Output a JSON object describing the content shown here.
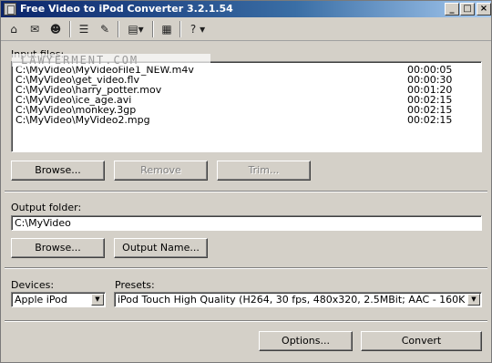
{
  "window": {
    "title": "Free Video to iPod Converter 3.2.1.54",
    "controls": {
      "minimize": "_",
      "maximize": "□",
      "close": "×"
    }
  },
  "toolbar": {
    "tools": [
      {
        "icon": "home-icon",
        "glyph": "⌂"
      },
      {
        "icon": "mail-icon",
        "glyph": "✉"
      },
      {
        "icon": "user-icon",
        "glyph": "☻"
      },
      {
        "icon": "list-icon",
        "glyph": "☰"
      },
      {
        "icon": "pencil-icon",
        "glyph": "✎"
      },
      {
        "icon": "window-menu-icon",
        "glyph": "▤▾"
      },
      {
        "icon": "film-icon",
        "glyph": "▦"
      },
      {
        "icon": "help-icon",
        "glyph": "? ▾"
      }
    ]
  },
  "watermark": "LAWYERMENT.COM",
  "input": {
    "label": "Input files:",
    "files": [
      {
        "path": "C:\\MyVideo\\MyVideoFile1_NEW.m4v",
        "duration": "00:00:05"
      },
      {
        "path": "C:\\MyVideo\\get_video.flv",
        "duration": "00:00:30"
      },
      {
        "path": "C:\\MyVideo\\harry_potter.mov",
        "duration": "00:01:20"
      },
      {
        "path": "C:\\MyVideo\\ice_age.avi",
        "duration": "00:02:15"
      },
      {
        "path": "C:\\MyVideo\\monkey.3gp",
        "duration": "00:02:15"
      },
      {
        "path": "C:\\MyVideo\\MyVideo2.mpg",
        "duration": "00:02:15"
      }
    ],
    "browse_label": "Browse...",
    "remove_label": "Remove",
    "trim_label": "Trim..."
  },
  "output": {
    "label": "Output folder:",
    "folder": "C:\\MyVideo",
    "browse_label": "Browse...",
    "name_label": "Output Name..."
  },
  "devices": {
    "label": "Devices:",
    "selected": "Apple iPod"
  },
  "presets": {
    "label": "Presets:",
    "selected": "iPod Touch High Quality (H264, 30 fps, 480x320, 2.5MBit; AAC - 160KBit)"
  },
  "actions": {
    "options_label": "Options...",
    "convert_label": "Convert"
  }
}
